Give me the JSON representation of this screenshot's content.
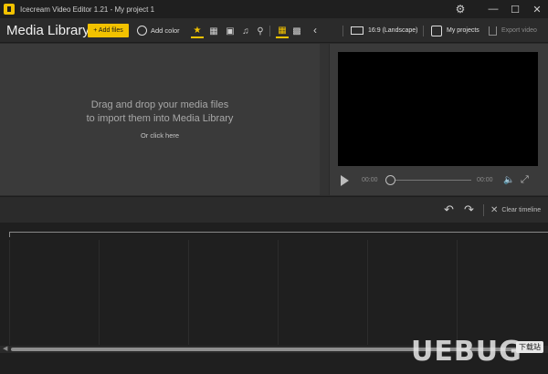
{
  "window": {
    "title": "Icecream Video Editor 1.21 - My project 1"
  },
  "toolbar": {
    "library_title": "Media Library",
    "add_files_label": "+ Add files",
    "add_color_label": "Add color",
    "filters": [
      "star-icon",
      "video-icon",
      "image-icon",
      "music-icon",
      "search-icon"
    ],
    "aspect_label": "16:9 (Landscape)",
    "my_projects_label": "My projects",
    "export_label": "Export video",
    "accent_color": "#f2c200"
  },
  "library": {
    "drop_line1": "Drag and drop your media files",
    "drop_line2": "to import them into Media Library",
    "or_click": "Or click here"
  },
  "preview": {
    "time_current": "00:00",
    "time_total": "00:00"
  },
  "timeline": {
    "clear_label": "Clear timeline"
  },
  "watermark": {
    "text": "UEBUG",
    "tag": "下载站"
  }
}
